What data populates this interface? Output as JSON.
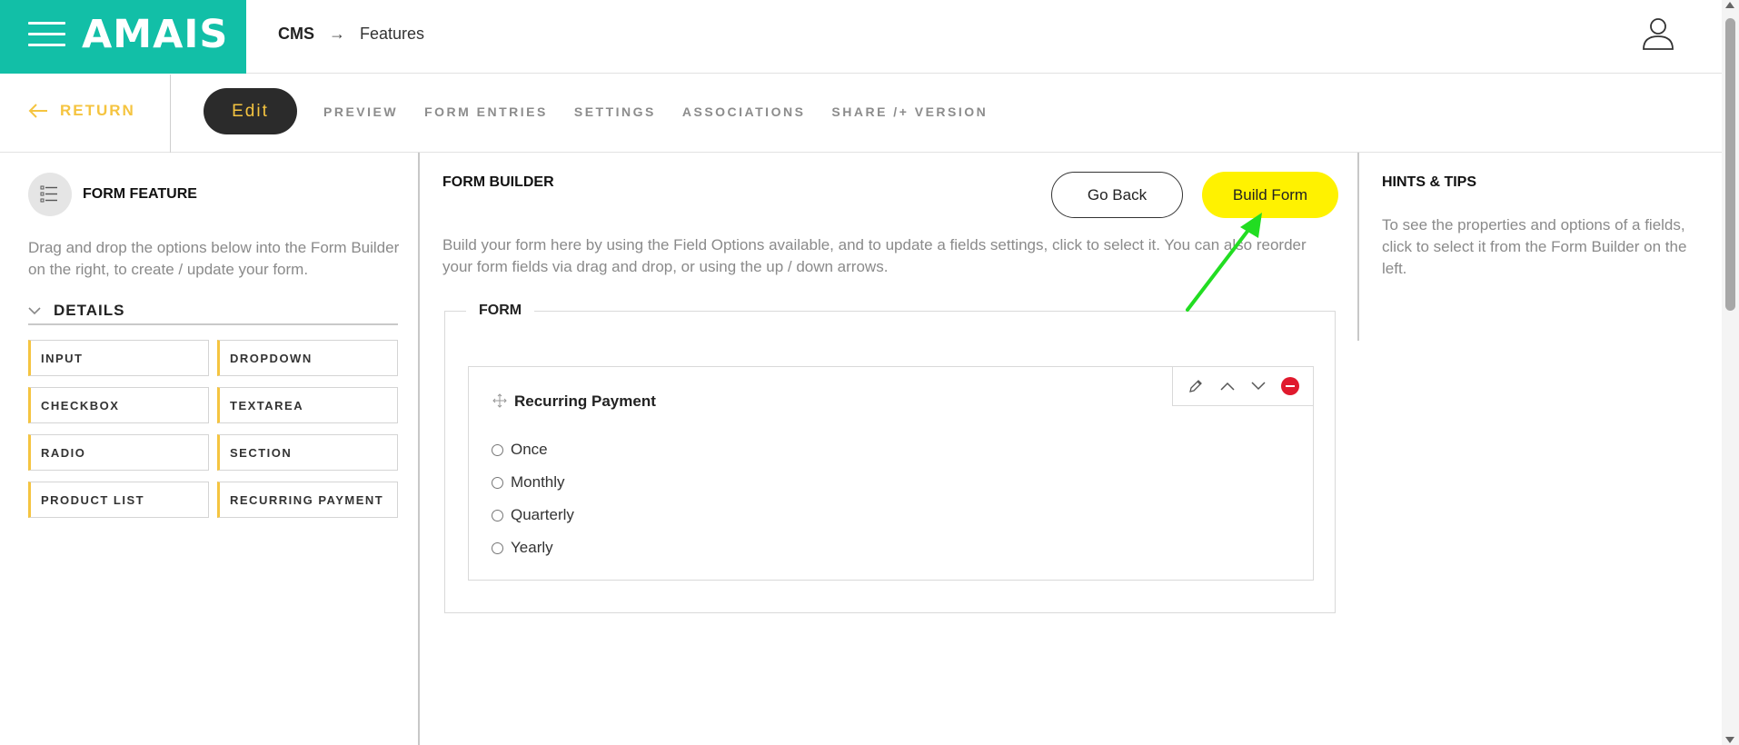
{
  "header": {
    "logo": "AMAIS",
    "breadcrumb": {
      "section": "CMS",
      "arrow": "→",
      "page": "Features"
    }
  },
  "subnav": {
    "return_label": "RETURN",
    "edit_label": "Edit",
    "tabs": [
      {
        "label": "PREVIEW"
      },
      {
        "label": "FORM ENTRIES"
      },
      {
        "label": "SETTINGS"
      },
      {
        "label": "ASSOCIATIONS"
      },
      {
        "label": "SHARE /+ VERSION"
      }
    ]
  },
  "left_panel": {
    "title": "FORM FEATURE",
    "description": "Drag and drop the options below into the Form Builder on the right, to create / update your form.",
    "details_label": "DETAILS",
    "field_options": [
      {
        "label": "INPUT"
      },
      {
        "label": "DROPDOWN"
      },
      {
        "label": "CHECKBOX"
      },
      {
        "label": "TEXTAREA"
      },
      {
        "label": "RADIO"
      },
      {
        "label": "SECTION"
      },
      {
        "label": "PRODUCT LIST"
      },
      {
        "label": "RECURRING PAYMENT"
      }
    ]
  },
  "form_builder": {
    "title": "FORM BUILDER",
    "go_back_label": "Go Back",
    "build_form_label": "Build Form",
    "description": "Build your form here by using the Field Options available, and to update a fields settings, click to select it. You can also reorder your form fields via drag and drop, or using the up / down arrows.",
    "form_legend": "FORM",
    "field": {
      "label": "Recurring Payment",
      "options": [
        "Once",
        "Monthly",
        "Quarterly",
        "Yearly"
      ]
    }
  },
  "hints": {
    "title": "HINTS & TIPS",
    "description": "To see the properties and options of a fields, click to select it from the Form Builder on the left."
  },
  "colors": {
    "brand": "#12bfa7",
    "accent_yellow": "#f5c440",
    "build_button": "#fff200",
    "edit_button_bg": "#2b2b2b",
    "delete_red": "#e0192d",
    "annotation_green": "#22dd22"
  },
  "icons": {
    "menu": "hamburger-icon",
    "user": "user-icon",
    "return": "arrow-left-icon",
    "drag": "move-icon",
    "edit": "pencil-icon",
    "up": "chevron-up-icon",
    "down": "chevron-down-icon",
    "delete": "minus-circle-icon"
  }
}
